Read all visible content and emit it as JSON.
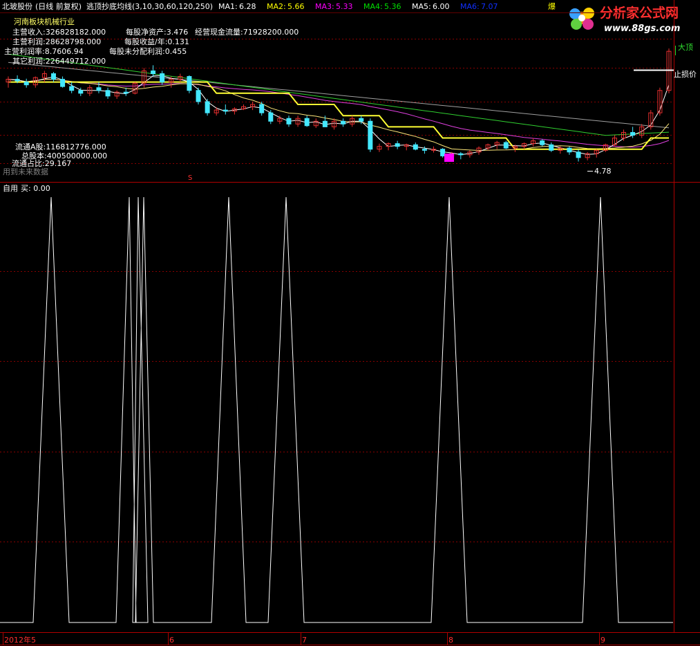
{
  "header": {
    "stock": "北玻股份",
    "period": "(日线 前复权)",
    "indicator": "逃顶抄底均线(3,10,30,60,120,250)",
    "ma": [
      {
        "label": "MA1:",
        "value": "6.28",
        "color": "#ffffff"
      },
      {
        "label": "MA2:",
        "value": "5.66",
        "color": "#ffff00"
      },
      {
        "label": "MA3:",
        "value": "5.33",
        "color": "#ff00ff"
      },
      {
        "label": "MA4:",
        "value": "5.36",
        "color": "#00e000"
      },
      {
        "label": "MA5:",
        "value": "6.00",
        "color": "#ffffff"
      },
      {
        "label": "MA6:",
        "value": "7.07",
        "color": "#1030ff"
      }
    ],
    "corner_text": "爆",
    "watermark": {
      "name": "分析家公式网",
      "url": "www.88gs.com"
    }
  },
  "info": {
    "industry": "河南板块机械行业",
    "main_income": "主营收入:326828182.000",
    "main_profit": "主营利润:28628798.000",
    "main_margin": "主营利润率:8.7606.94",
    "other_profit": "其它利润:226449712.000",
    "nav_per_share": "每股净资产:3.476",
    "op_cashflow": "经营现金流量:71928200.000",
    "eps_year": "每股收益/年:0.131",
    "undistributed": "每股未分配利润:0.455",
    "float_a": "流通A股:116812776.000",
    "total_shares": "总股本:400500000.000",
    "float_ratio": "流通占比:29.167",
    "future_data": "用到未来数据",
    "marker_s": "S"
  },
  "annotations": {
    "top_label": "大顶",
    "stop_label": "止损价",
    "low_label": "4.78"
  },
  "sub": {
    "title": "自用",
    "buy": "买: 0.00"
  },
  "xaxis": {
    "labels": [
      "2012年5",
      "6",
      "7",
      "8",
      "9"
    ]
  },
  "colors": {
    "background": "#000000",
    "up": "#e83030",
    "down": "#44e8ff",
    "grid": "#8a0000",
    "ma_short": "#ffffff",
    "ma_mid": "#ffe87a",
    "ma_yellow": "#ffff33",
    "ma_magenta": "#e040e0",
    "ma_green": "#30d030",
    "ma_long": "#a0a0a0"
  },
  "chart_data": {
    "type": "line",
    "series_price": {
      "low": 4.78,
      "candles_ohlc": [
        [
          6.2,
          6.3,
          6.1,
          6.25
        ],
        [
          6.25,
          6.32,
          6.18,
          6.22
        ],
        [
          6.2,
          6.26,
          6.1,
          6.15
        ],
        [
          6.15,
          6.3,
          6.1,
          6.28
        ],
        [
          6.28,
          6.4,
          6.2,
          6.35
        ],
        [
          6.35,
          6.38,
          6.2,
          6.25
        ],
        [
          6.25,
          6.3,
          6.1,
          6.12
        ],
        [
          6.12,
          6.2,
          6.0,
          6.05
        ],
        [
          6.05,
          6.1,
          5.95,
          6.0
        ],
        [
          6.0,
          6.15,
          5.95,
          6.1
        ],
        [
          6.1,
          6.2,
          6.0,
          6.05
        ],
        [
          6.05,
          6.1,
          5.9,
          5.95
        ],
        [
          5.95,
          6.05,
          5.9,
          6.02
        ],
        [
          6.02,
          6.1,
          5.95,
          6.0
        ],
        [
          6.0,
          6.2,
          5.98,
          6.18
        ],
        [
          6.18,
          6.45,
          6.1,
          6.4
        ],
        [
          6.4,
          6.5,
          6.3,
          6.35
        ],
        [
          6.35,
          6.4,
          6.15,
          6.2
        ],
        [
          6.2,
          6.3,
          6.1,
          6.25
        ],
        [
          6.25,
          6.35,
          6.2,
          6.3
        ],
        [
          6.3,
          6.32,
          6.0,
          6.05
        ],
        [
          6.05,
          6.1,
          5.8,
          5.85
        ],
        [
          5.85,
          5.9,
          5.6,
          5.65
        ],
        [
          5.65,
          5.75,
          5.6,
          5.7
        ],
        [
          5.7,
          5.8,
          5.62,
          5.68
        ],
        [
          5.68,
          5.75,
          5.62,
          5.72
        ],
        [
          5.72,
          5.8,
          5.7,
          5.76
        ],
        [
          5.76,
          5.85,
          5.7,
          5.8
        ],
        [
          5.8,
          5.85,
          5.6,
          5.65
        ],
        [
          5.65,
          5.7,
          5.45,
          5.5
        ],
        [
          5.5,
          5.6,
          5.45,
          5.55
        ],
        [
          5.55,
          5.6,
          5.4,
          5.45
        ],
        [
          5.45,
          5.6,
          5.4,
          5.55
        ],
        [
          5.55,
          5.6,
          5.4,
          5.42
        ],
        [
          5.42,
          5.55,
          5.38,
          5.5
        ],
        [
          5.5,
          5.6,
          5.45,
          5.4
        ],
        [
          5.4,
          5.55,
          5.35,
          5.5
        ],
        [
          5.5,
          5.55,
          5.4,
          5.45
        ],
        [
          5.45,
          5.6,
          5.4,
          5.55
        ],
        [
          5.55,
          5.6,
          5.45,
          5.5
        ],
        [
          5.5,
          5.55,
          4.95,
          5.0
        ],
        [
          5.0,
          5.1,
          4.95,
          5.05
        ],
        [
          5.05,
          5.12,
          4.98,
          5.1
        ],
        [
          5.1,
          5.15,
          5.0,
          5.05
        ],
        [
          5.05,
          5.1,
          4.98,
          5.08
        ],
        [
          5.08,
          5.12,
          4.98,
          5.0
        ],
        [
          5.0,
          5.05,
          4.92,
          4.98
        ],
        [
          4.98,
          5.05,
          4.94,
          5.0
        ],
        [
          5.0,
          5.02,
          4.85,
          4.88
        ],
        [
          4.88,
          4.95,
          4.8,
          4.92
        ],
        [
          4.92,
          4.95,
          4.82,
          4.9
        ],
        [
          4.9,
          4.98,
          4.85,
          4.95
        ],
        [
          4.95,
          5.05,
          4.9,
          5.02
        ],
        [
          5.02,
          5.1,
          4.98,
          5.08
        ],
        [
          5.08,
          5.15,
          5.0,
          5.12
        ],
        [
          5.12,
          5.15,
          5.0,
          5.02
        ],
        [
          5.02,
          5.08,
          4.95,
          5.05
        ],
        [
          5.05,
          5.12,
          5.0,
          5.1
        ],
        [
          5.1,
          5.2,
          5.05,
          5.15
        ],
        [
          5.15,
          5.18,
          5.05,
          5.08
        ],
        [
          5.08,
          5.12,
          4.95,
          4.98
        ],
        [
          4.98,
          5.05,
          4.92,
          5.02
        ],
        [
          5.02,
          5.05,
          4.9,
          4.95
        ],
        [
          4.95,
          5.0,
          4.78,
          4.85
        ],
        [
          4.85,
          4.95,
          4.8,
          4.92
        ],
        [
          4.92,
          5.0,
          4.85,
          4.98
        ],
        [
          4.98,
          5.1,
          4.95,
          5.08
        ],
        [
          5.08,
          5.25,
          5.05,
          5.2
        ],
        [
          5.2,
          5.35,
          5.15,
          5.3
        ],
        [
          5.3,
          5.4,
          5.2,
          5.25
        ],
        [
          5.25,
          5.45,
          5.2,
          5.4
        ],
        [
          5.4,
          5.7,
          5.35,
          5.65
        ],
        [
          5.65,
          6.1,
          5.6,
          6.05
        ],
        [
          6.05,
          6.8,
          6.0,
          6.75
        ]
      ]
    },
    "sub_signal_peaks": [
      {
        "x_label": "2012年5",
        "value": 1
      },
      {
        "x_label": "6",
        "value": 1
      },
      {
        "x_label": "6",
        "value": 1
      },
      {
        "x_label": "6",
        "value": 1
      },
      {
        "x_label": "7",
        "value": 1
      },
      {
        "x_label": "8",
        "value": 1
      },
      {
        "x_label": "9",
        "value": 1
      }
    ]
  }
}
